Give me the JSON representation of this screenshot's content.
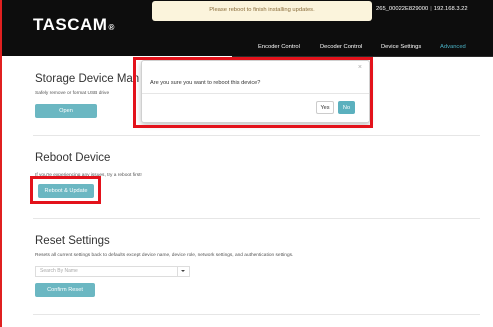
{
  "header": {
    "logo": "TASCAM",
    "logo_mark": "®",
    "notice": "Please reboot to finish installing updates.",
    "device_id": "265_00022E829000",
    "ip": "192.168.3.22"
  },
  "nav": {
    "items": [
      "Encoder Control",
      "Decoder Control",
      "Device Settings",
      "Advanced"
    ],
    "active": "Advanced"
  },
  "storage": {
    "title": "Storage Device Man",
    "desc": "Safely remove or format USB drive",
    "button": "Open"
  },
  "reboot": {
    "title": "Reboot Device",
    "desc": "If you're experiencing any issues, try a reboot first!",
    "button": "Reboot & Update"
  },
  "reset": {
    "title": "Reset Settings",
    "desc": "Resets all current settings back to defaults except device name, device role, network settings, and authentication settings.",
    "select_placeholder": "Search By Name",
    "button": "Confirm Reset"
  },
  "modal": {
    "close_symbol": "×",
    "message": "Are you sure you want to reboot this device?",
    "yes_label": "Yes",
    "no_label": "No"
  },
  "colors": {
    "accent": "#6bb7c2",
    "highlight": "#e3121b",
    "topbar": "#0d0d0d",
    "notice_bg": "#fbf4dc"
  }
}
